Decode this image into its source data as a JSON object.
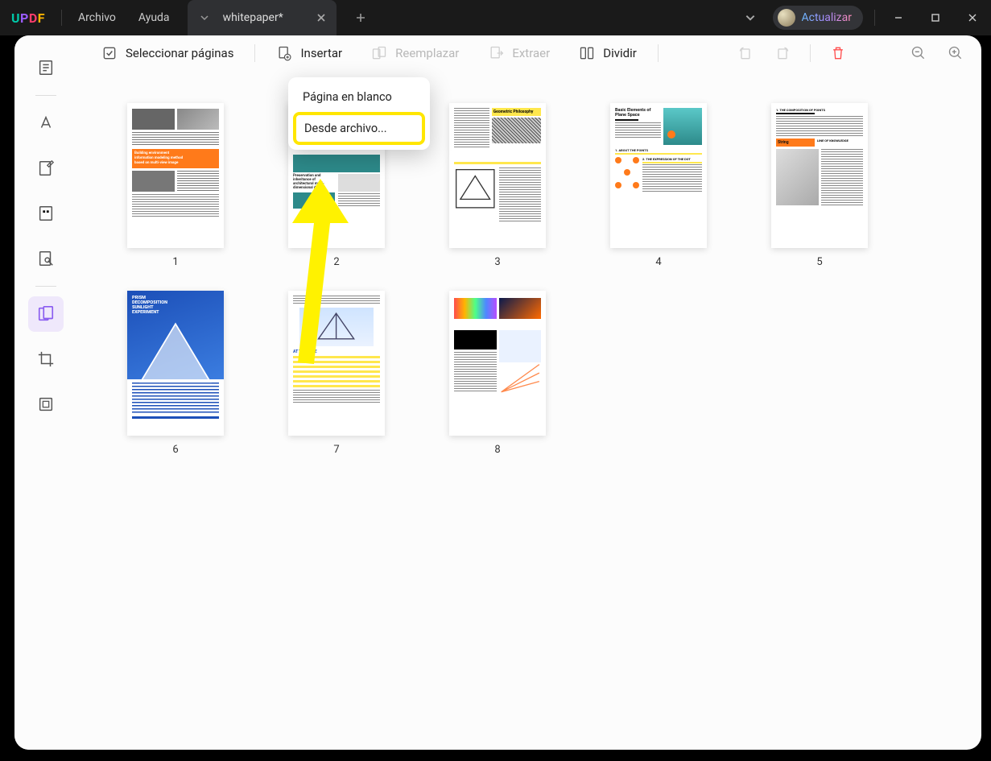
{
  "app": {
    "logo": "UPDF"
  },
  "menus": {
    "file": "Archivo",
    "help": "Ayuda"
  },
  "tab": {
    "title": "whitepaper*"
  },
  "titlebar": {
    "update": "Actualizar"
  },
  "toolbar": {
    "select_pages": "Seleccionar páginas",
    "insert": "Insertar",
    "replace": "Reemplazar",
    "extract": "Extraer",
    "split": "Dividir"
  },
  "popover": {
    "blank_page": "Página en blanco",
    "from_file": "Desde archivo..."
  },
  "pages": {
    "p1": "1",
    "p2": "2",
    "p3": "3",
    "p4": "4",
    "p5": "5",
    "p6": "6",
    "p7": "7",
    "p8": "8"
  },
  "thumbnails": {
    "p1": {
      "title1": "Building environment",
      "title2": "information modeling method",
      "title3": "based on multi-view image"
    },
    "p2": {
      "title1": "Preservation and",
      "title2": "inheritance of",
      "title3": "architectural multi-",
      "title4": "dimensional data"
    },
    "p3": {
      "title": "Geometric Philosophy"
    },
    "p4": {
      "title1": "Basic Elements of",
      "title2": "Plane Space",
      "sub1": "1. ABOUT THE POINTS",
      "sub2": "2. THE EXPRESSION OF THE DOT"
    },
    "p5": {
      "sub1": "1. THE COMPOSITION OF POINTS",
      "band": "String",
      "sub2": "LINE OF KNOWLEDGE"
    },
    "p6": {
      "title1": "PRISM",
      "title2": "DECOMPOSITION",
      "title3": "SUNLIGHT",
      "title4": "EXPERIMENT"
    },
    "p7": {
      "title": "AT THE TIME"
    },
    "p8": {}
  }
}
